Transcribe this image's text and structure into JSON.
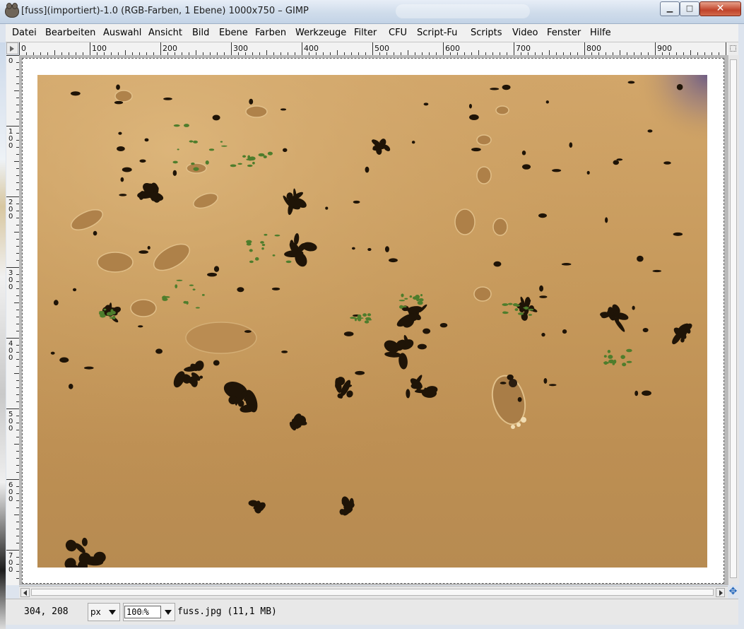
{
  "window": {
    "title": "[fuss](importiert)-1.0 (RGB-Farben, 1 Ebene) 1000x750 – GIMP",
    "buttons": {
      "minimize": "▁",
      "maximize": "□",
      "close": "✕"
    }
  },
  "menu": [
    "Datei",
    "Bearbeiten",
    "Auswahl",
    "Ansicht",
    "Bild",
    "Ebene",
    "Farben",
    "Werkzeuge",
    "Filter",
    "CFU",
    "Script-Fu",
    "Scripts",
    "Video",
    "Fenster",
    "Hilfe"
  ],
  "ruler": {
    "horizontal_labels": [
      "0",
      "100",
      "200",
      "300",
      "400",
      "500",
      "600",
      "700",
      "800",
      "900"
    ],
    "vertical_labels": [
      "0",
      "100",
      "200",
      "300",
      "400",
      "500",
      "600",
      "700"
    ]
  },
  "status": {
    "coordinates": "304, 208",
    "unit": "px",
    "zoom": "100",
    "zoom_suffix": "%",
    "file_info": "fuss.jpg (11,1 MB)"
  },
  "icons": {
    "app": "gimp-wilber-icon",
    "navigate": "navigate-icon",
    "quick-mask": "quick-mask-icon"
  },
  "colors": {
    "sand": "#c79a5c",
    "canvas_bg": "#ffffff",
    "titlebar": "#cfdceb"
  }
}
